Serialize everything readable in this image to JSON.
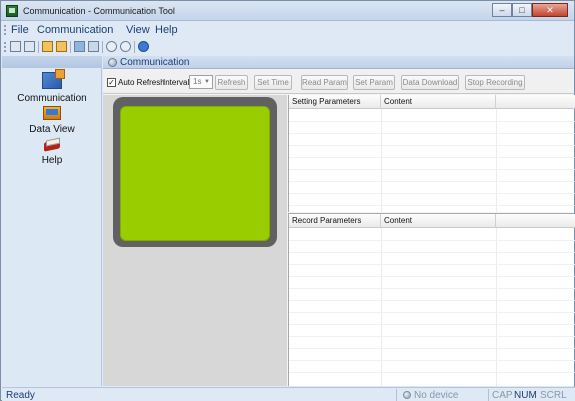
{
  "window": {
    "title": "Communication - Communication Tool",
    "btn_min": "–",
    "btn_max": "□",
    "btn_close": "✕"
  },
  "menu": {
    "items": [
      "File",
      "Communication",
      "View",
      "Help"
    ]
  },
  "toolbar": {
    "icons": [
      "save-icon",
      "save-all-icon",
      "open-folder-icon",
      "folder-icon",
      "print-icon",
      "copy-icon",
      "stop-icon",
      "refresh-icon",
      "about-icon"
    ]
  },
  "sidebar": {
    "items": [
      {
        "label": "Communication",
        "icon": "communication-icon"
      },
      {
        "label": "Data View",
        "icon": "data-view-icon"
      },
      {
        "label": "Help",
        "icon": "help-book-icon"
      }
    ]
  },
  "panel": {
    "title": "Communication"
  },
  "controls": {
    "auto_refresh_label": "Auto Refresh",
    "auto_refresh_checked": true,
    "check_mark": "✓",
    "interval_label": "Interval:",
    "interval_value": "1s",
    "dropdown_arrow": "▼",
    "refresh": "Refresh",
    "set_time": "Set Time",
    "read_param": "Read Param",
    "set_param": "Set Param",
    "data_download": "Data Download",
    "stop_recording": "Stop Recording"
  },
  "settings_table": {
    "col1": "Setting Parameters",
    "col2": "Content"
  },
  "record_table": {
    "col1": "Record Parameters",
    "col2": "Content"
  },
  "status": {
    "ready": "Ready",
    "device": "No device",
    "cap": "CAP",
    "num": "NUM",
    "scrl": "SCRL"
  }
}
